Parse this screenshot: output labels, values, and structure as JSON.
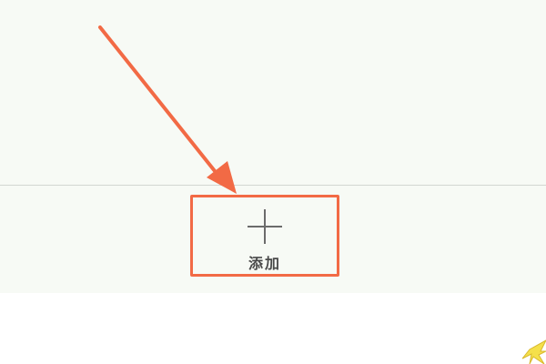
{
  "toolbar": {
    "add_label": "添加",
    "add_icon": "plus-icon"
  },
  "annotation": {
    "arrow_color": "#f26a45",
    "box_color": "#f26a45"
  },
  "colors": {
    "panel_background": "#f7faf5",
    "divider": "#d2d6d1",
    "icon_stroke": "#6b6b6b",
    "label_text": "#4a4a4a"
  }
}
